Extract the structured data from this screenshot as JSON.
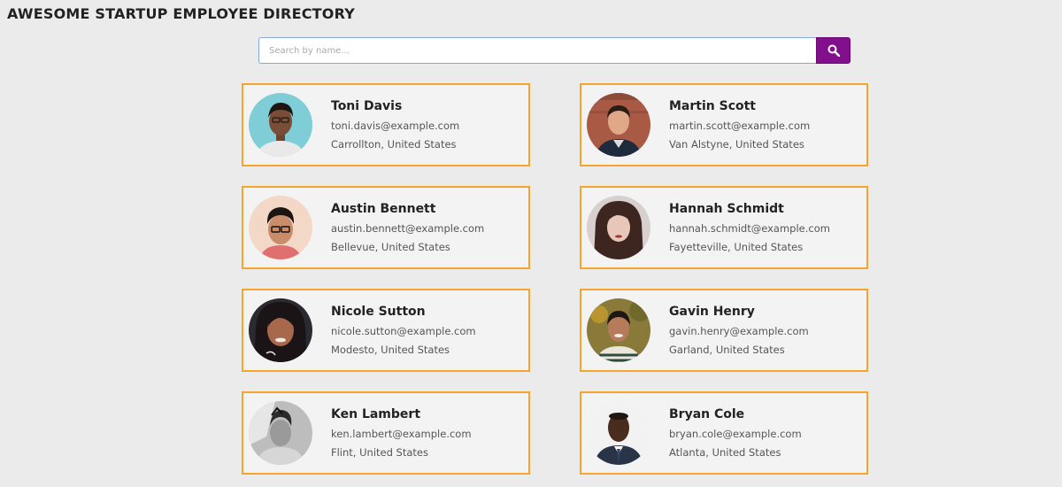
{
  "header": {
    "title": "AWESOME STARTUP EMPLOYEE DIRECTORY"
  },
  "search": {
    "placeholder": "Search by name...",
    "value": "",
    "button_icon": "search-icon",
    "button_color": "#820f8c"
  },
  "colors": {
    "background": "#ebebeb",
    "card_border": "#f5a52c",
    "card_background": "#f4f3f4"
  },
  "employees": [
    {
      "name": "Toni Davis",
      "email": "toni.davis@example.com",
      "location": "Carrollton, United States",
      "avatar": "photo-avatar"
    },
    {
      "name": "Martin Scott",
      "email": "martin.scott@example.com",
      "location": "Van Alstyne, United States",
      "avatar": "photo-avatar"
    },
    {
      "name": "Austin Bennett",
      "email": "austin.bennett@example.com",
      "location": "Bellevue, United States",
      "avatar": "photo-avatar"
    },
    {
      "name": "Hannah Schmidt",
      "email": "hannah.schmidt@example.com",
      "location": "Fayetteville, United States",
      "avatar": "photo-avatar"
    },
    {
      "name": "Nicole Sutton",
      "email": "nicole.sutton@example.com",
      "location": "Modesto, United States",
      "avatar": "photo-avatar"
    },
    {
      "name": "Gavin Henry",
      "email": "gavin.henry@example.com",
      "location": "Garland, United States",
      "avatar": "photo-avatar"
    },
    {
      "name": "Ken Lambert",
      "email": "ken.lambert@example.com",
      "location": "Flint, United States",
      "avatar": "photo-avatar"
    },
    {
      "name": "Bryan Cole",
      "email": "bryan.cole@example.com",
      "location": "Atlanta, United States",
      "avatar": "photo-avatar"
    }
  ]
}
